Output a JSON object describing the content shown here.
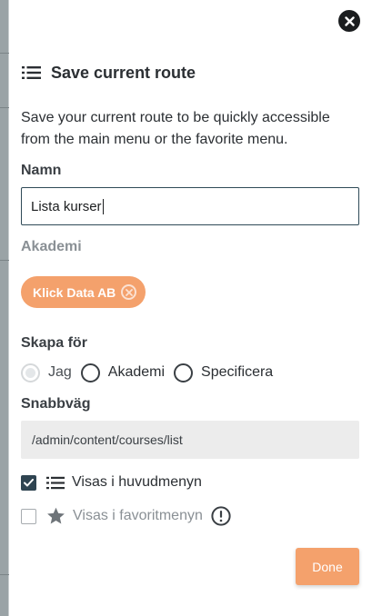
{
  "dialog": {
    "title": "Save current route",
    "description": "Save your current route to be quickly accessible from the main menu or the favorite menu."
  },
  "form": {
    "name_label": "Namn",
    "name_value": "Lista kurser",
    "academy_label": "Akademi",
    "academy_chip": "Klick Data AB",
    "create_for_label": "Skapa för",
    "create_for_options": [
      "Jag",
      "Akademi",
      "Specificera"
    ],
    "create_for_selected": "Jag",
    "shortcut_label": "Snabbväg",
    "shortcut_value": "/admin/content/courses/list",
    "show_main_menu_label": "Visas i huvudmenyn",
    "show_main_menu_checked": true,
    "show_favorite_menu_label": "Visas i favoritmenyn",
    "show_favorite_menu_checked": false
  },
  "actions": {
    "done_label": "Done"
  },
  "icons": {
    "close": "close-icon",
    "title": "list-icon",
    "chip_remove": "remove-chip-icon",
    "main_menu": "list-icon",
    "favorite": "star-icon",
    "warning": "exclamation-circle-icon"
  },
  "colors": {
    "accent": "#f4a16c",
    "checkbox_on": "#2f4451",
    "input_border": "#2f4a57"
  }
}
